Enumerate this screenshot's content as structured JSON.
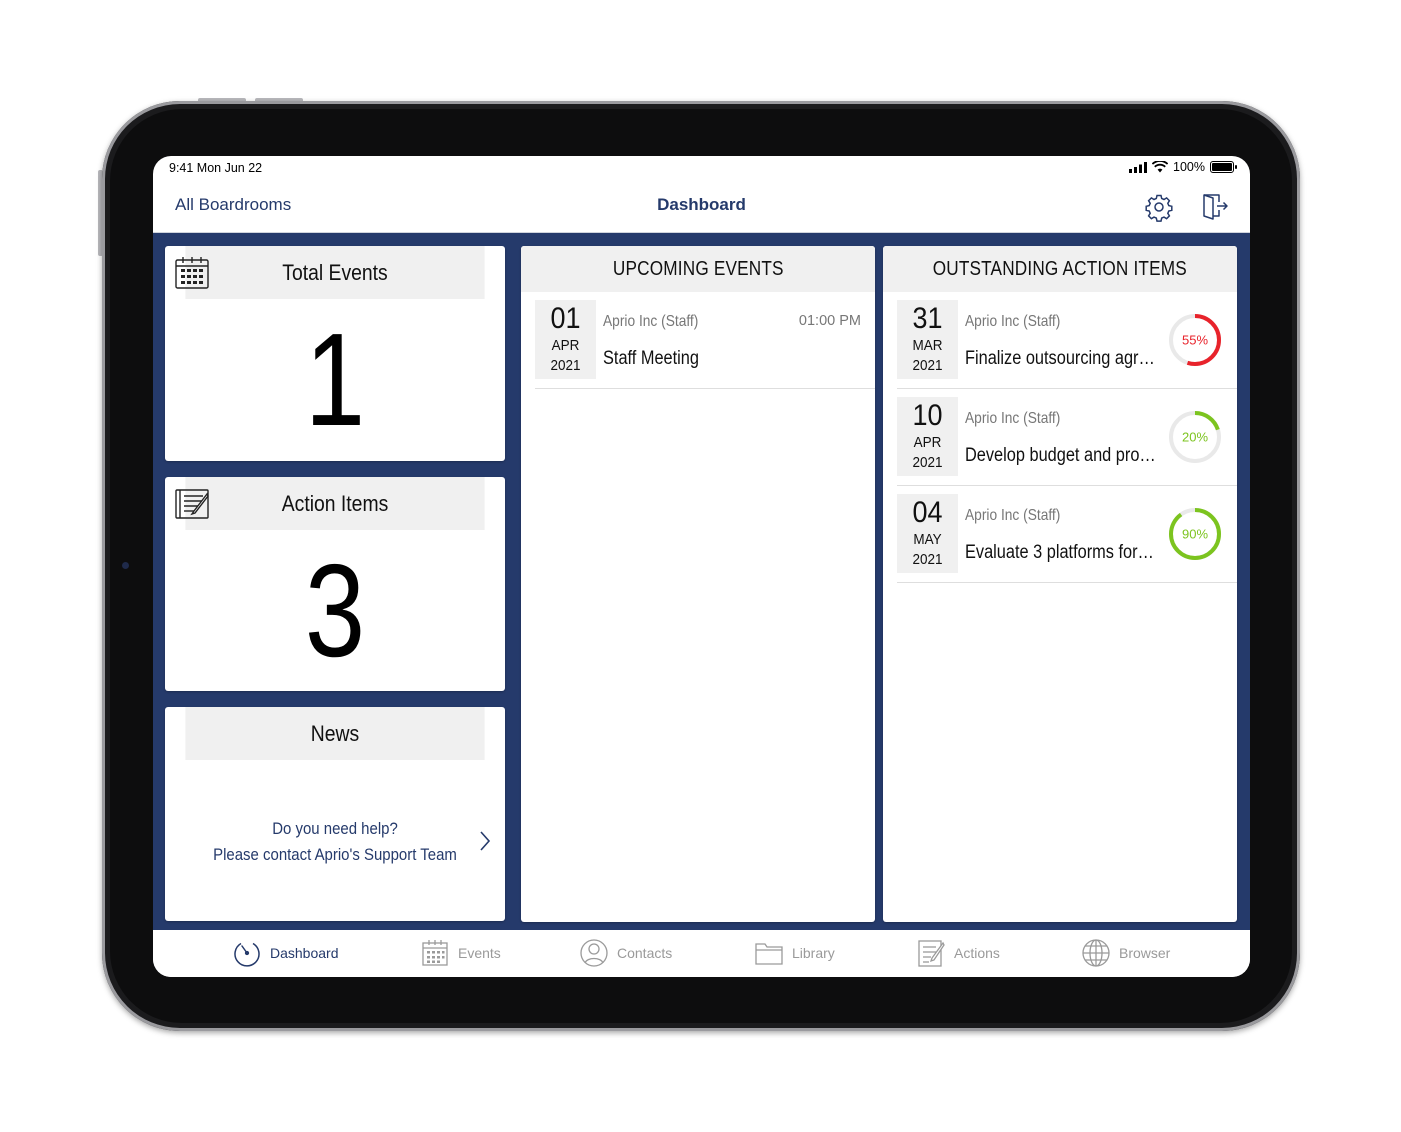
{
  "status_bar": {
    "time": "9:41  Mon Jun 22",
    "battery": "100%"
  },
  "nav": {
    "back_label": "All Boardrooms",
    "title": "Dashboard"
  },
  "stats": {
    "total_events": {
      "title": "Total Events",
      "value": "1"
    },
    "action_items": {
      "title": "Action Items",
      "value": "3"
    }
  },
  "news": {
    "title": "News",
    "line1": "Do you need help?",
    "line2": "Please contact Aprio's Support Team"
  },
  "upcoming": {
    "title": "UPCOMING EVENTS",
    "items": [
      {
        "day": "01",
        "month": "APR",
        "year": "2021",
        "org": "Aprio Inc (Staff)",
        "title": "Staff Meeting",
        "time": "01:00 PM"
      }
    ]
  },
  "actions": {
    "title": "OUTSTANDING ACTION ITEMS",
    "items": [
      {
        "day": "31",
        "month": "MAR",
        "year": "2021",
        "org": "Aprio Inc (Staff)",
        "title": "Finalize outsourcing agr…",
        "progress": "55%",
        "progress_value": 0.55,
        "color": "#e8232b"
      },
      {
        "day": "10",
        "month": "APR",
        "year": "2021",
        "org": "Aprio Inc (Staff)",
        "title": "Develop budget and pro…",
        "progress": "20%",
        "progress_value": 0.2,
        "color": "#7cc41f"
      },
      {
        "day": "04",
        "month": "MAY",
        "year": "2021",
        "org": "Aprio Inc (Staff)",
        "title": "Evaluate 3 platforms for…",
        "progress": "90%",
        "progress_value": 0.9,
        "color": "#7cc41f"
      }
    ]
  },
  "tabs": [
    {
      "label": "Dashboard",
      "icon": "dashboard-icon",
      "active": true
    },
    {
      "label": "Events",
      "icon": "calendar-icon",
      "active": false
    },
    {
      "label": "Contacts",
      "icon": "person-icon",
      "active": false
    },
    {
      "label": "Library",
      "icon": "folder-icon",
      "active": false
    },
    {
      "label": "Actions",
      "icon": "action-list-icon",
      "active": false
    },
    {
      "label": "Browser",
      "icon": "globe-icon",
      "active": false
    }
  ],
  "colors": {
    "brand_navy": "#253a6b",
    "card_header": "#f0f0f0",
    "overdue_red": "#e8232b",
    "progress_green": "#7cc41f"
  }
}
